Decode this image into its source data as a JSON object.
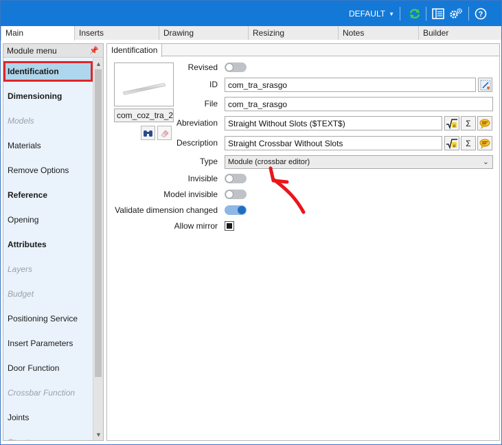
{
  "topbar": {
    "profile": "DEFAULT",
    "icons": [
      "refresh-icon",
      "layout-icon",
      "settings-icon",
      "help-icon"
    ]
  },
  "tabs": [
    "Main",
    "Inserts",
    "Drawing",
    "Resizing",
    "Notes",
    "Builder"
  ],
  "menu": {
    "title": "Module menu",
    "items": [
      {
        "label": "Identification",
        "style": "selected"
      },
      {
        "label": "Dimensioning",
        "style": "bold"
      },
      {
        "label": "Models",
        "style": "disabled"
      },
      {
        "label": "Materials",
        "style": "normal"
      },
      {
        "label": "Remove Options",
        "style": "normal"
      },
      {
        "label": "Reference",
        "style": "bold"
      },
      {
        "label": "Opening",
        "style": "normal"
      },
      {
        "label": "Attributes",
        "style": "bold"
      },
      {
        "label": "Layers",
        "style": "disabled"
      },
      {
        "label": "Budget",
        "style": "disabled"
      },
      {
        "label": "Positioning Service",
        "style": "normal"
      },
      {
        "label": "Insert Parameters",
        "style": "normal"
      },
      {
        "label": "Door Function",
        "style": "normal"
      },
      {
        "label": "Crossbar Function",
        "style": "disabled"
      },
      {
        "label": "Joints",
        "style": "normal"
      },
      {
        "label": "Structures",
        "style": "disabled"
      }
    ]
  },
  "panel": {
    "tab": "Identification",
    "thumbnail_name": "com_coz_tra_2",
    "fields": {
      "revised_label": "Revised",
      "id_label": "ID",
      "id_value": "com_tra_srasgo",
      "file_label": "File",
      "file_value": "com_tra_srasgo",
      "abbrev_label": "Abreviation",
      "abbrev_value": "Straight Without Slots ($TEXT$)",
      "desc_label": "Description",
      "desc_value": "Straight Crossbar Without Slots",
      "type_label": "Type",
      "type_value": "Module (crossbar editor)",
      "invisible_label": "Invisible",
      "model_invisible_label": "Model invisible",
      "validate_label": "Validate dimension changed",
      "mirror_label": "Allow mirror"
    },
    "states": {
      "revised": false,
      "invisible": false,
      "model_invisible": false,
      "validate_dimension_changed": true,
      "allow_mirror": true
    },
    "formula_symbol": "√a",
    "sum_symbol": "Σ"
  },
  "colors": {
    "topbar": "#1479d6",
    "selection_highlight": "#aed6ec",
    "selection_border": "#e0262a",
    "annotation_arrow": "#e8161b"
  }
}
